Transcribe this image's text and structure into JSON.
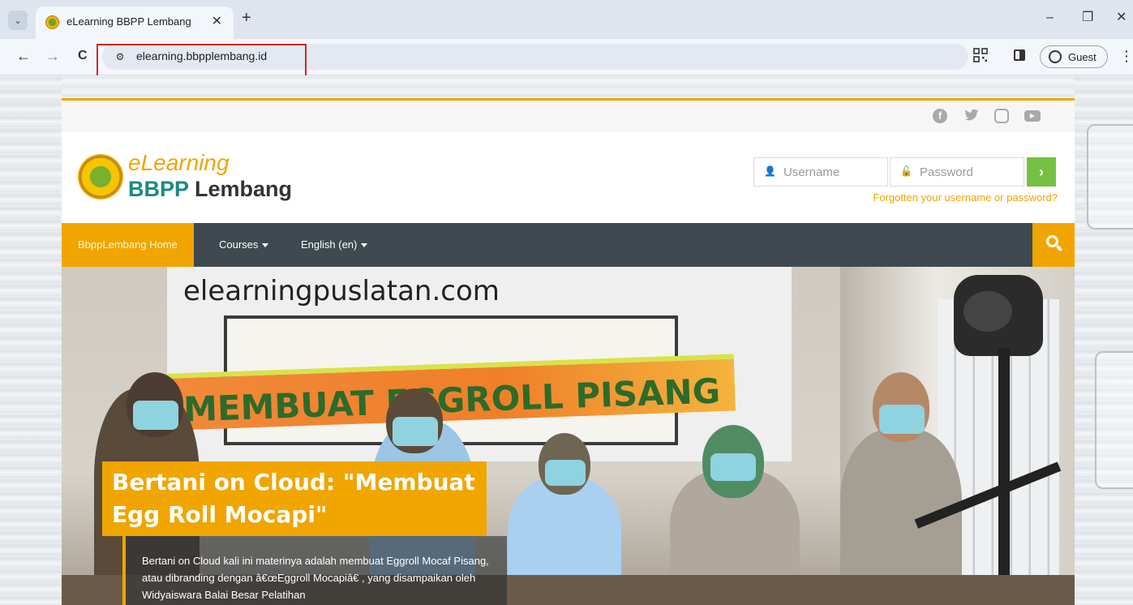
{
  "browser": {
    "tab": {
      "title": "eLearning BBPP Lembang",
      "close": "✕"
    },
    "new_tab": "+",
    "window_controls": {
      "minimize": "–",
      "restore": "❐",
      "close": "✕"
    },
    "nav": {
      "back": "←",
      "forward": "→",
      "reload": "C"
    },
    "address_bar": {
      "url": "elearning.bbpplembang.id",
      "site_info_icon": "tune-icon"
    },
    "profile": {
      "label": "Guest"
    },
    "menu": "⋮"
  },
  "site": {
    "social": {
      "facebook": "f",
      "twitter": "🐦",
      "instagram": "",
      "youtube": "▶"
    },
    "logo": {
      "title": "eLearning",
      "sub_bold": "BBPP",
      "sub_rest": " Lembang"
    },
    "login": {
      "username_placeholder": "Username",
      "password_placeholder": "Password",
      "submit": "›",
      "forgot": "Forgotten your username or password?"
    },
    "navbar": {
      "items": [
        {
          "label": "BbppLembang Home",
          "active": true
        },
        {
          "label": "Courses",
          "dropdown": true
        },
        {
          "label": "English (en)",
          "dropdown": true
        }
      ]
    },
    "hero": {
      "banner_text": "elearningpuslatan.com",
      "ribbon_text": "MEMBUAT EGGROLL PISANG",
      "caption_title": "Bertani on Cloud: \"Membuat Egg Roll Mocapi\"",
      "caption_body": "Bertani on Cloud kali ini materinya adalah membuat Eggroll Mocaf Pisang, atau dibranding dengan â€œEggroll Mocapiâ€  , yang disampaikan oleh Widyaiswara Balai Besar Pelatihan"
    }
  },
  "colors": {
    "accent": "#f0a500",
    "nav": "#3f4a50",
    "brand_green": "#1c8a80",
    "login_btn": "#76c043",
    "highlight": "#d82424"
  }
}
